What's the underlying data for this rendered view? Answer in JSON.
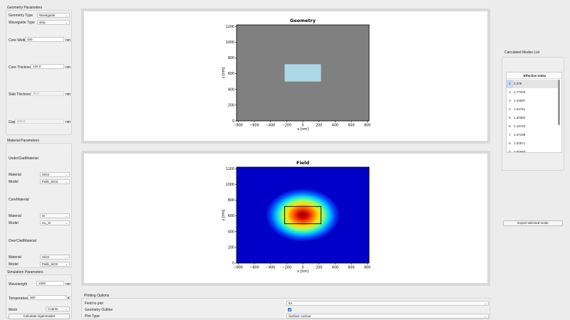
{
  "geometry_params": {
    "title": "Geometry Parameters",
    "geometry_type_label": "Geometry Type",
    "geometry_type_value": "Waveguide",
    "waveguide_type_label": "Waveguide Type",
    "waveguide_type_value": "strip",
    "core_width_label": "Core Width",
    "core_width_value": "450",
    "core_width_unit": "nm",
    "core_thickness_label": "Core Thickness",
    "core_thickness_value": "220.0",
    "core_thickness_unit": "nm",
    "slab_thickness_label": "Slab Thickness",
    "slab_thickness_value": "70.0",
    "slab_thickness_unit": "nm",
    "gap_label": "Gap",
    "gap_value": "200.0",
    "gap_unit": "nm"
  },
  "material_params": {
    "title": "Material Parameters",
    "sections": [
      {
        "name": "UnderCladMaterial",
        "material_label": "Material",
        "material_value": "SiO2",
        "model_label": "Model",
        "model_value": "Palik_SiO2"
      },
      {
        "name": "CoreMaterial",
        "material_label": "Material",
        "material_value": "Si",
        "model_label": "Model",
        "model_value": "Xu_Si"
      },
      {
        "name": "OverCladMaterial",
        "material_label": "Material",
        "material_value": "SiO2",
        "model_label": "Model",
        "model_value": "Palik_SiO2"
      }
    ]
  },
  "simulation_params": {
    "title": "Simulation Parameters",
    "wavelength_label": "Wavelength",
    "wavelength_value": "1550",
    "wavelength_unit": "nm",
    "temperature_label": "Temperature",
    "temperature_value": "300",
    "temperature_unit": "K",
    "mesh_label": "Mesh",
    "mesh_value": "Coarse",
    "calculate_button": "Calculate eigenmodes"
  },
  "geometry_plot": {
    "title": "Geometry",
    "xlabel": "x [nm]",
    "ylabel": "y [nm]",
    "xticks": [
      "−800",
      "−600",
      "−400",
      "−200",
      "0",
      "200",
      "400",
      "600",
      "800"
    ],
    "yticks": [
      "0",
      "200",
      "400",
      "600",
      "800",
      "1000",
      "1200"
    ],
    "xlim": [
      -820,
      820
    ],
    "ylim": [
      0,
      1220
    ],
    "cladding_color": "#808080",
    "core_color": "#add8e6",
    "core_rect": {
      "x0": -225,
      "x1": 225,
      "y0": 500,
      "y1": 720
    }
  },
  "field_plot": {
    "title": "Field",
    "xlabel": "x [nm]",
    "ylabel": "y [nm]",
    "xticks": [
      "−800",
      "−600",
      "−400",
      "−200",
      "0",
      "200",
      "400",
      "600",
      "800"
    ],
    "yticks": [
      "0",
      "200",
      "400",
      "600",
      "800",
      "1000",
      "1200"
    ],
    "xlim": [
      -820,
      820
    ],
    "ylim": [
      0,
      1220
    ],
    "colormap": "jet",
    "field_center": {
      "x": 0,
      "y": 610
    }
  },
  "modes": {
    "title": "Calculated Modes List",
    "column_header": "Effective index",
    "rows": [
      {
        "index": "1",
        "value": "2.379"
      },
      {
        "index": "2",
        "value": "1.77333"
      },
      {
        "index": "3",
        "value": "1.44597"
      },
      {
        "index": "4",
        "value": "1.34761"
      },
      {
        "index": "5",
        "value": "1.30382"
      },
      {
        "index": "6",
        "value": "1.19722"
      },
      {
        "index": "7",
        "value": "1.07199"
      },
      {
        "index": "8",
        "value": "1.02971"
      },
      {
        "index": "9",
        "value": "0.96869"
      }
    ],
    "export_button": "Export selected mode"
  },
  "plotting_options": {
    "title": "Plotting Options",
    "field_label": "Field to plot",
    "field_value": "Ex",
    "outline_label": "Geometry Outline",
    "outline_checked": true,
    "plot_type_label": "Plot Type",
    "plot_type_value": "Surface contour"
  }
}
